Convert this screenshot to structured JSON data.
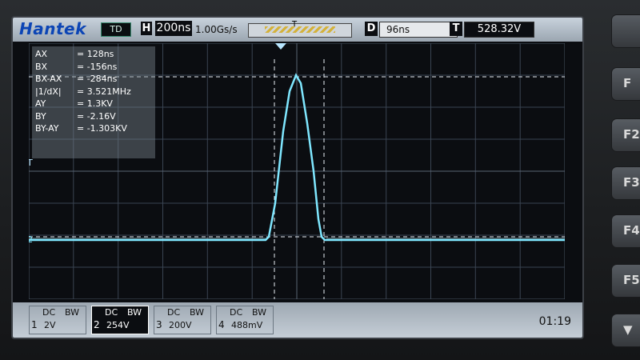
{
  "header": {
    "brand": "Hantek",
    "mode": "TD",
    "h_label": "H",
    "timebase": "200ns",
    "sample_rate": "1.00Gs/s",
    "trigger_marker": "T",
    "d_label": "D",
    "delay": "96ns",
    "t_label": "T",
    "trigger_level": "528.32V"
  },
  "cursors": [
    {
      "label": "AX",
      "value": "= 128ns"
    },
    {
      "label": "BX",
      "value": "= -156ns"
    },
    {
      "label": "BX-AX",
      "value": "= -284ns"
    },
    {
      "label": "|1/dX|",
      "value": "= 3.521MHz"
    },
    {
      "label": "AY",
      "value": "= 1.3KV"
    },
    {
      "label": "BY",
      "value": "= -2.16V"
    },
    {
      "label": "BY-AY",
      "value": "= -1.303KV"
    }
  ],
  "markers": {
    "trigger_side": "T",
    "channel_ref": "2"
  },
  "channels": [
    {
      "num": "1",
      "coupling": "DC",
      "bw": "BW",
      "scale": "2V",
      "active": false
    },
    {
      "num": "2",
      "coupling": "DC",
      "bw": "BW",
      "scale": "254V",
      "active": true
    },
    {
      "num": "3",
      "coupling": "DC",
      "bw": "BW",
      "scale": "200V",
      "active": false
    },
    {
      "num": "4",
      "coupling": "DC",
      "bw": "BW",
      "scale": "488mV",
      "active": false
    }
  ],
  "clock": "01:19",
  "side_buttons": [
    "",
    "F",
    "F2",
    "F3",
    "F4",
    "F5",
    "▼"
  ],
  "colors": {
    "trace": "#7fe7ff",
    "grid": "#3a4452",
    "cursor": "#e8eef5"
  }
}
